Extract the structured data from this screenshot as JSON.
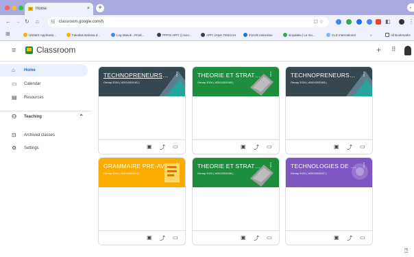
{
  "browser": {
    "tab_title": "Home",
    "tab_close": "×",
    "new_tab": "+",
    "url": "classroom.google.com/h",
    "bookmarks": [
      {
        "label": "UNNES Applicatio...",
        "color": "#f4b400"
      },
      {
        "label": "Fakultas Bahasa d...",
        "color": "#f4b400"
      },
      {
        "label": "Log Masuk › Prodi...",
        "color": "#4285f4"
      },
      {
        "label": "PPPSI APFI || Asso...",
        "color": "#3c4043"
      },
      {
        "label": "APFI JAWA TENGAH",
        "color": "#3c4043"
      },
      {
        "label": "IFprofs Indonésie",
        "color": "#1a73e8"
      },
      {
        "label": "sinyalaka | Le mo...",
        "color": "#34a853"
      },
      {
        "label": "CLE International",
        "color": "#8ab4f8"
      }
    ],
    "more_bookmarks": "»",
    "all_bookmarks": "All Bookmarks"
  },
  "app": {
    "name": "Classroom",
    "plus": "+",
    "grid": "⋮⋮⋮"
  },
  "sidebar": {
    "items": [
      {
        "label": "Home",
        "icon": "home-icon"
      },
      {
        "label": "Calendar",
        "icon": "calendar-icon"
      },
      {
        "label": "Resources",
        "icon": "resources-icon"
      },
      {
        "label": "Teaching",
        "icon": "teaching-icon"
      },
      {
        "label": "Archived classes",
        "icon": "archive-icon"
      },
      {
        "label": "Settings",
        "icon": "gear-icon"
      }
    ]
  },
  "classes": [
    {
      "title": "TECHNOPRENEURSH...",
      "subtitle": "Genap 2024 ( #2024203181 )",
      "color": "#37474f"
    },
    {
      "title": "THEORIE ET STRATEG...",
      "subtitle": "Genap 2024 ( #2024203169 )",
      "color": "#1e8e3e"
    },
    {
      "title": "TECHNOPRENEURSH...",
      "subtitle": "Genap 2024 ( #2024203183 )",
      "color": "#37474f"
    },
    {
      "title": "GRAMMAIRE PRE-AV...",
      "subtitle": "Genap 2024 ( #2024203414 )",
      "color": "#f9ab00"
    },
    {
      "title": "THEORIE ET STRATEG...",
      "subtitle": "Genap 2024 ( #2024203166 )",
      "color": "#1e8e3e"
    },
    {
      "title": "TECHNOLOGIES DE L...",
      "subtitle": "Genap 2024 ( #2024203647 )",
      "color": "#7e57c2"
    }
  ],
  "help": "?"
}
